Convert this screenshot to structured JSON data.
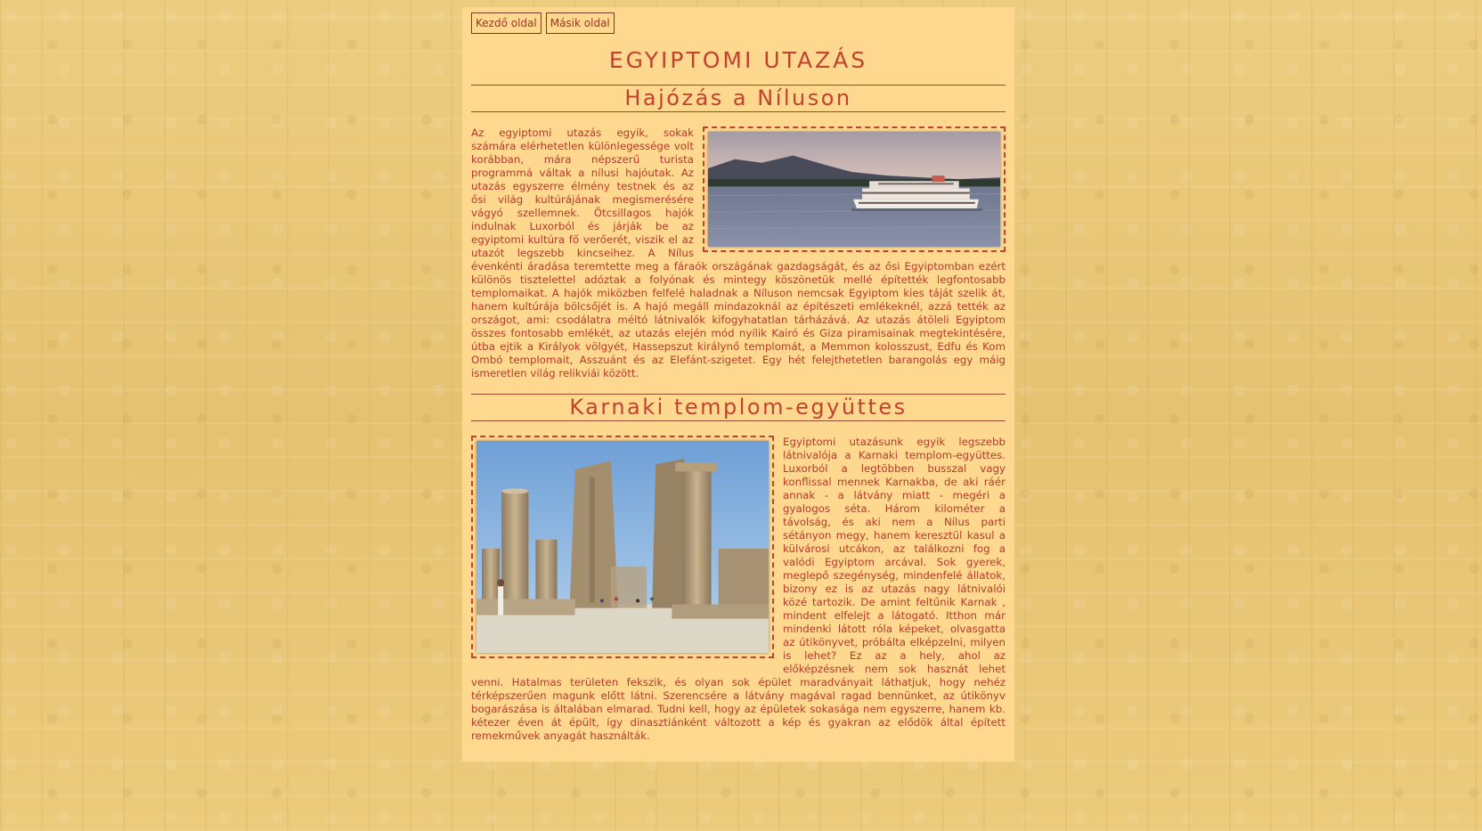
{
  "nav": {
    "home_label": "Kezdő oldal",
    "other_label": "Másik oldal"
  },
  "page_title": "EGYIPTOMI UTAZÁS",
  "section1": {
    "title": "Hajózás a Níluson",
    "text": "Az egyiptomi utazás egyik, sokak számára elérhetetlen különlegessége volt korábban, mára népszerű turista programmá váltak a nílusi hajóutak. Az utazás egyszerre élmény testnek és az ősi világ kultúrájának megismerésére vágyó szellemnek. Ötcsillagos hajók indulnak Luxorból és járják be az egyiptomi kultúra fő verőerét, viszik el az utazót legszebb kincseihez. A Nílus évenkénti áradása teremtette meg a fáraók országának gazdagságát, és az ősi Egyiptomban ezért különös tisztelettel adóztak a folyónak és mintegy köszönetük mellé építették legfontosabb templomaikat. A hajók miközben felfelé haladnak a Níluson nemcsak Egyiptom kies táját szelik át, hanem kultúrája bölcsőjét is. A hajó megáll mindazoknál az építészeti emlékeknél, azzá tették az országot, ami: csodálatra méltó látnivalók kifogyhatatlan tárházává. Az utazás átöleli Egyiptom összes fontosabb emlékét, az utazás elején mód nyílik Kairó és Giza piramisainak megtekintésére, útba ejtik a Királyok völgyét, Hassepszut királynő templomát, a Memmon kolosszust, Edfu és Kom Ombó templomait, Asszuánt és az Elefánt-szigetet. Egy hét felejthetetlen barangolás egy máig ismeretlen világ relikviái között."
  },
  "section2": {
    "title": "Karnaki templom-együttes",
    "text": "Egyiptomi utazásunk egyik legszebb látnivalója a Karnaki templom-együttes. Luxorból a legtöbben busszal vagy konflissal mennek Karnakba, de aki ráér annak - a látvány miatt - megéri a gyalogos séta. Három kilométer a távolság, és aki nem a Nílus parti sétányon megy, hanem keresztül kasul a külvárosi utcákon, az találkozni fog a valódi Egyiptom arcával. Sok gyerek, meglepő szegénység, mindenfelé állatok, bizony ez is az utazás nagy látnivalói közé tartozik. De amint feltűnik Karnak , mindent elfelejt a látogató. Itthon már mindenki látott róla képeket, olvasgatta az útikönyvet, próbálta elképzelni, milyen is lehet? Ez az a hely, ahol az előképzésnek nem sok hasznát lehet venni. Hatalmas területen fekszik, és olyan sok épület maradványait láthatjuk, hogy nehéz térképszerűen magunk előtt látni. Szerencsére a látvány magával ragad bennünket, az útikönyv bogarászása is általában elmarad. Tudni kell, hogy az épületek sokasága nem egyszerre, hanem kb. kétezer éven át épült, így dinasztiánként változott a kép és gyakran az elődök által épített remekművek anyagát használták."
  },
  "colors": {
    "page_background": "#e9c877",
    "content_background": "#ffd890",
    "text": "#b53a2a",
    "heading": "#c0432e"
  }
}
